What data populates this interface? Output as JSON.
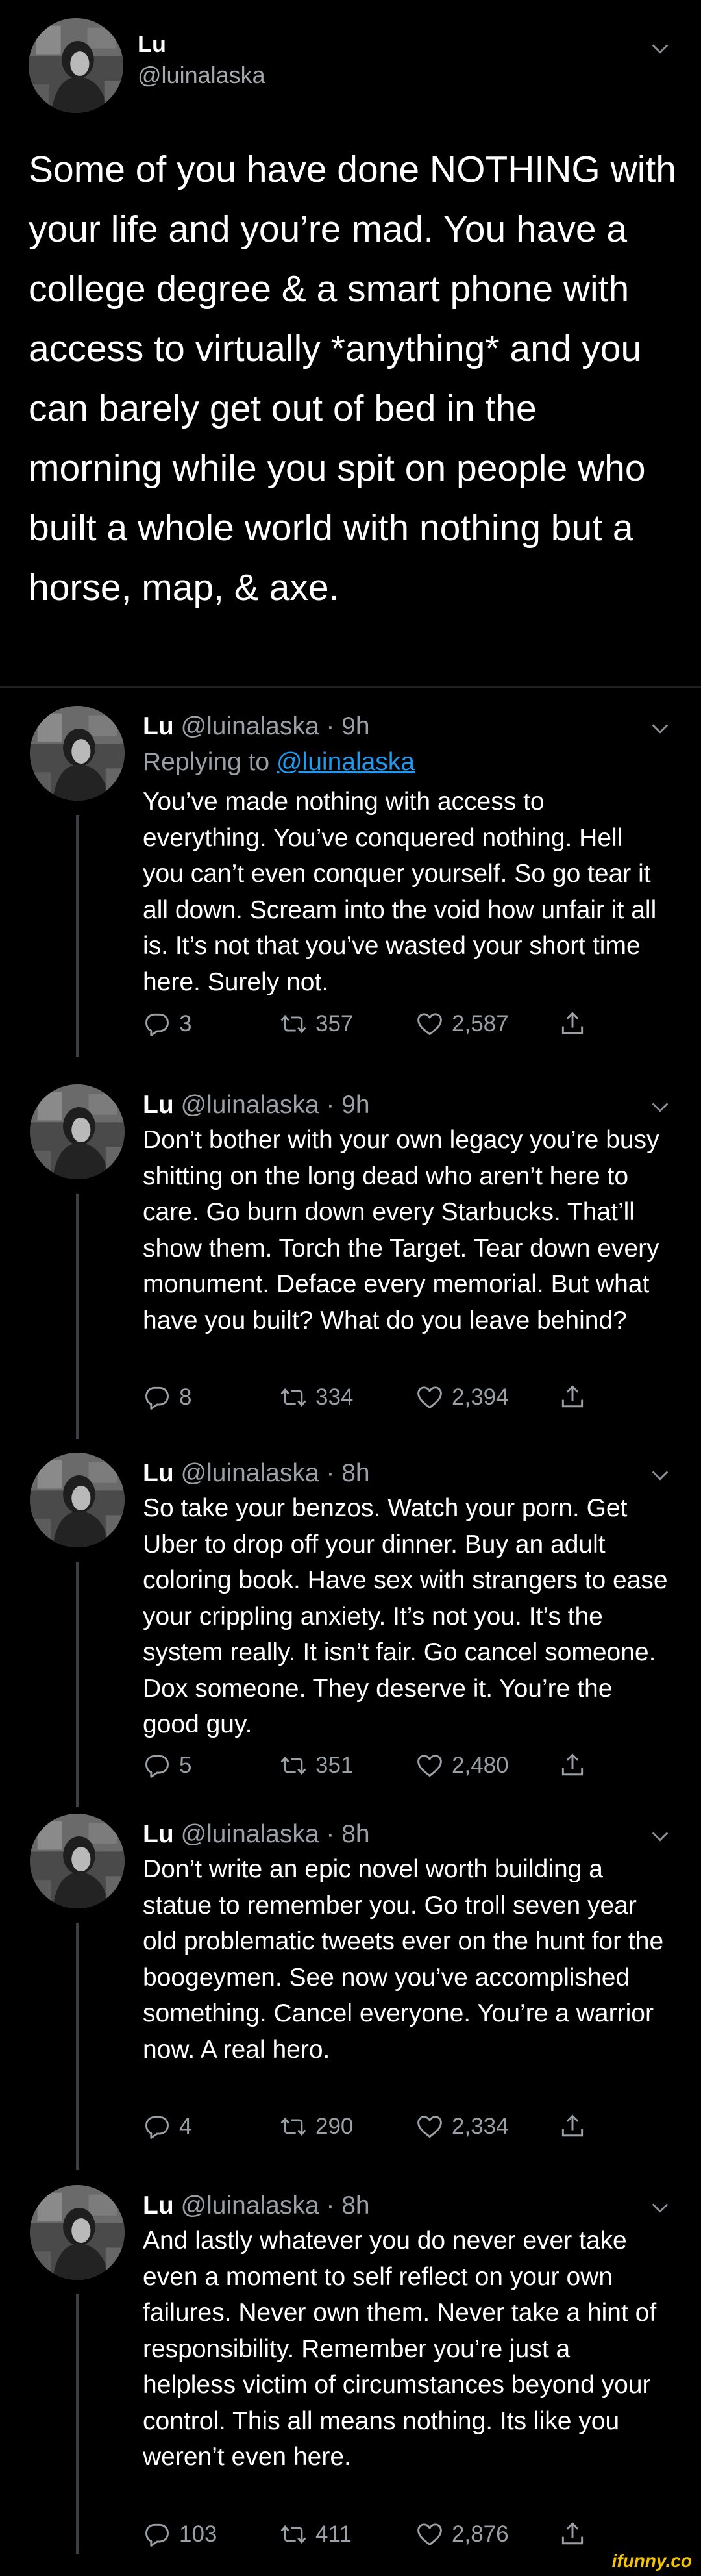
{
  "main_tweet": {
    "name": "Lu",
    "handle": "@luinalaska",
    "text": "Some of you have done NOTHING with your life and you’re mad. You have a college degree & a smart phone with access to virtually *anything* and you can barely get out of bed in the morning while you spit on people who built a whole world with nothing but a horse, map, & axe."
  },
  "replies": [
    {
      "name": "Lu",
      "handle_time": "@luinalaska · 9h",
      "replying_prefix": "Replying to ",
      "replying_to": "@luinalaska",
      "text": "You’ve made nothing with access to everything. You’ve conquered nothing. Hell you can’t even conquer yourself. So go tear it all down. Scream into the void how unfair it all is. It’s not that you’ve wasted your short time here. Surely not.",
      "replies": "3",
      "retweets": "357",
      "likes": "2,587"
    },
    {
      "name": "Lu",
      "handle_time": "@luinalaska · 9h",
      "text": "Don’t bother with your own legacy you’re busy shitting on the long dead who aren’t here to care. Go burn down every Starbucks. That’ll show them. Torch the Target. Tear down every monument. Deface every memorial. But what have you built? What do you leave behind?",
      "replies": "8",
      "retweets": "334",
      "likes": "2,394"
    },
    {
      "name": "Lu",
      "handle_time": "@luinalaska · 8h",
      "text": "So take your benzos. Watch your porn. Get Uber to drop off your dinner. Buy an adult coloring book. Have sex with strangers to ease your crippling anxiety. It’s not you. It’s the system really. It isn’t fair. Go cancel someone. Dox someone. They deserve it. You’re the good guy.",
      "replies": "5",
      "retweets": "351",
      "likes": "2,480"
    },
    {
      "name": "Lu",
      "handle_time": "@luinalaska · 8h",
      "text": "Don’t write an epic novel worth building a statue to remember you. Go troll seven year old problematic tweets ever on the hunt for the boogeymen. See now you’ve accomplished something. Cancel everyone. You’re a warrior now. A real hero.",
      "replies": "4",
      "retweets": "290",
      "likes": "2,334"
    },
    {
      "name": "Lu",
      "handle_time": "@luinalaska · 8h",
      "text": "And lastly whatever you do never ever take even a moment to self reflect on your own failures. Never own them. Never take a hint of responsibility. Remember you’re just a helpless victim of circumstances beyond your control. This all means nothing. Its like you weren’t even here.",
      "replies": "103",
      "retweets": "411",
      "likes": "2,876"
    }
  ],
  "watermark": "ifunny.co",
  "colors": {
    "background": "#000000",
    "secondary_text": "#9aa0a5",
    "link": "#1d9bf0",
    "thread_line": "#3c4045"
  }
}
